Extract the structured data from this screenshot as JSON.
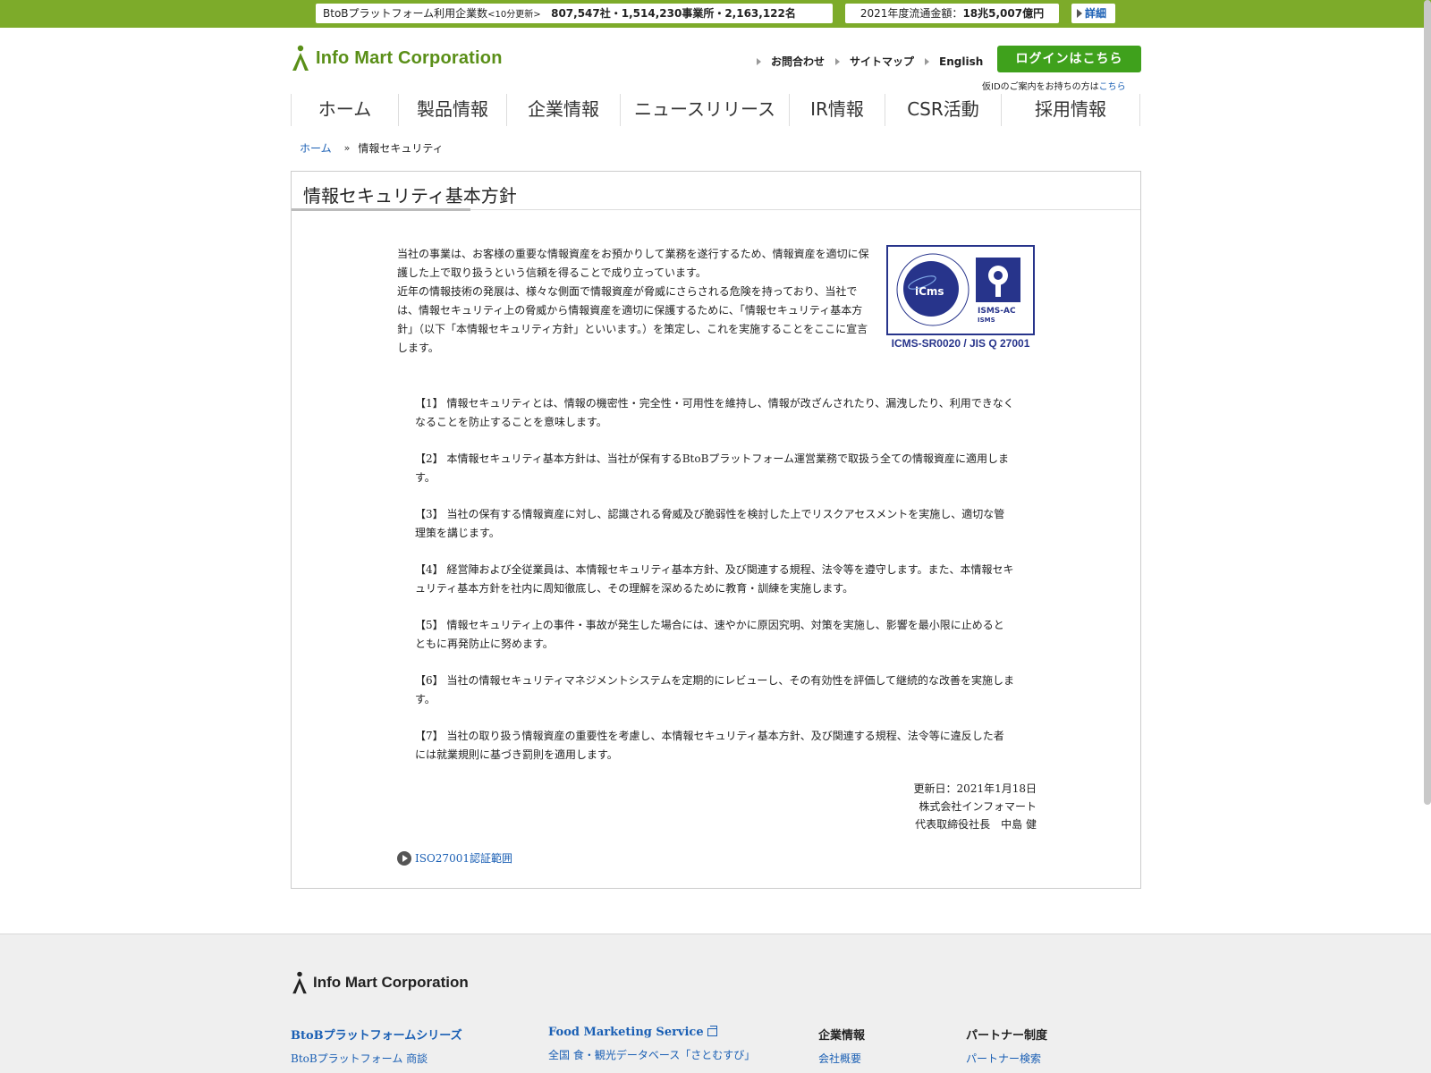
{
  "topbar": {
    "stat_label": "BtoBプラットフォーム利用企業数",
    "stat_note": "<10分更新>",
    "stat_values": "807,547社・1,514,230事業所・2,163,122名",
    "gmv_label": "2021年度流通金額：",
    "gmv_value": "18兆5,007億円",
    "detail_label": "詳細"
  },
  "header": {
    "logo_text": "Info Mart Corporation",
    "util_links": [
      "お問合わせ",
      "サイトマップ",
      "English"
    ],
    "login_label": "ログインはこちら",
    "login_note": "仮IDのご案内をお持ちの方は",
    "login_note_link": "こちら"
  },
  "gnav": [
    "ホーム",
    "製品情報",
    "企業情報",
    "ニュースリリース",
    "IR情報",
    "CSR活動",
    "採用情報"
  ],
  "breadcrumb": {
    "home": "ホーム",
    "separator": "»",
    "current": "情報セキュリティ"
  },
  "main": {
    "title": "情報セキュリティ基本方針",
    "intro_1": "当社の事業は、お客様の重要な情報資産をお預かりして業務を遂行するため、情報資産を適切に保護した上で取り扱うという信頼を得ることで成り立っています。",
    "intro_2": "近年の情報技術の発展は、様々な側面で情報資産が脅威にさらされる危険を持っており、当社では、情報セキュリティ上の脅威から情報資産を適切に保護するために、「情報セキュリティ基本方針」（以下「本情報セキュリティ方針」といいます。）を策定し、これを実施することをここに宣言します。",
    "cert_caption": "ICMS-SR0020 / JIS Q 27001",
    "articles": [
      "【1】 情報セキュリティとは、情報の機密性・完全性・可用性を維持し、情報が改ざんされたり、漏洩したり、利用できなくなることを防止することを意味します。",
      "【2】 本情報セキュリティ基本方針は、当社が保有するBtoBプラットフォーム運営業務で取扱う全ての情報資産に適用します。",
      "【3】 当社の保有する情報資産に対し、認識される脅威及び脆弱性を検討した上でリスクアセスメントを実施し、適切な管理策を講じます。",
      "【4】 経営陣および全従業員は、本情報セキュリティ基本方針、及び関連する規程、法令等を遵守します。また、本情報セキュリティ基本方針を社内に周知徹底し、その理解を深めるために教育・訓練を実施します。",
      "【5】 情報セキュリティ上の事件・事故が発生した場合には、速やかに原因究明、対策を実施し、影響を最小限に止めるとともに再発防止に努めます。",
      "【6】 当社の情報セキュリティマネジメントシステムを定期的にレビューし、その有効性を評価して継続的な改善を実施します。",
      "【7】 当社の取り扱う情報資産の重要性を考慮し、本情報セキュリティ基本方針、及び関連する規程、法令等に違反した者には就業規則に基づき罰則を適用します。"
    ],
    "updated": "更新日：2021年1月18日",
    "company": "株式会社インフォマート",
    "ceo": "代表取締役社長　中島 健",
    "iso_link": "ISO27001認証範囲"
  },
  "footer": {
    "logo_text": "Info Mart Corporation",
    "columns": [
      {
        "head": "BtoBプラットフォームシリーズ",
        "item": "BtoBプラットフォーム 商談"
      },
      {
        "head": "Food Marketing Service",
        "item": "全国 食・観光データベース「さとむすび」"
      },
      {
        "head": "企業情報",
        "item": "会社概要"
      },
      {
        "head": "パートナー制度",
        "item": "パートナー検索"
      }
    ]
  },
  "colors": {
    "brand_green": "#7dab2a",
    "logo_green": "#5a8f18",
    "login_green": "#3fa11c",
    "link_blue": "#1a5fb4",
    "cert_navy": "#27348b"
  }
}
